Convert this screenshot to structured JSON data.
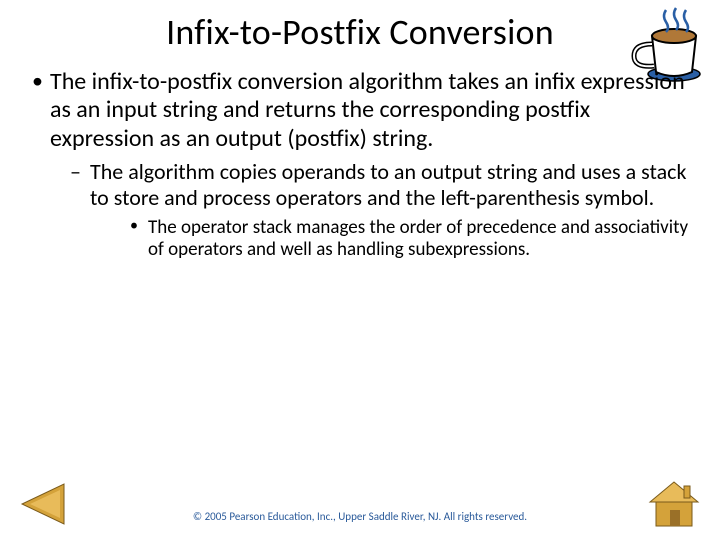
{
  "title": "Infix-to-Postfix Conversion",
  "bullets": {
    "l1": "The infix-to-postfix conversion algorithm takes an infix expression as an input string and returns the corresponding postfix expression as an output (postfix) string.",
    "l2": "The algorithm copies operands to an output string and uses a stack to store and process operators and the left-parenthesis symbol.",
    "l3": "The operator stack manages the order of precedence and associativity of operators and well as handling subexpressions."
  },
  "copyright": "© 2005 Pearson Education, Inc., Upper Saddle River, NJ.  All rights reserved.",
  "icons": {
    "cup": "coffee-cup",
    "back": "back-arrow",
    "home": "home"
  }
}
